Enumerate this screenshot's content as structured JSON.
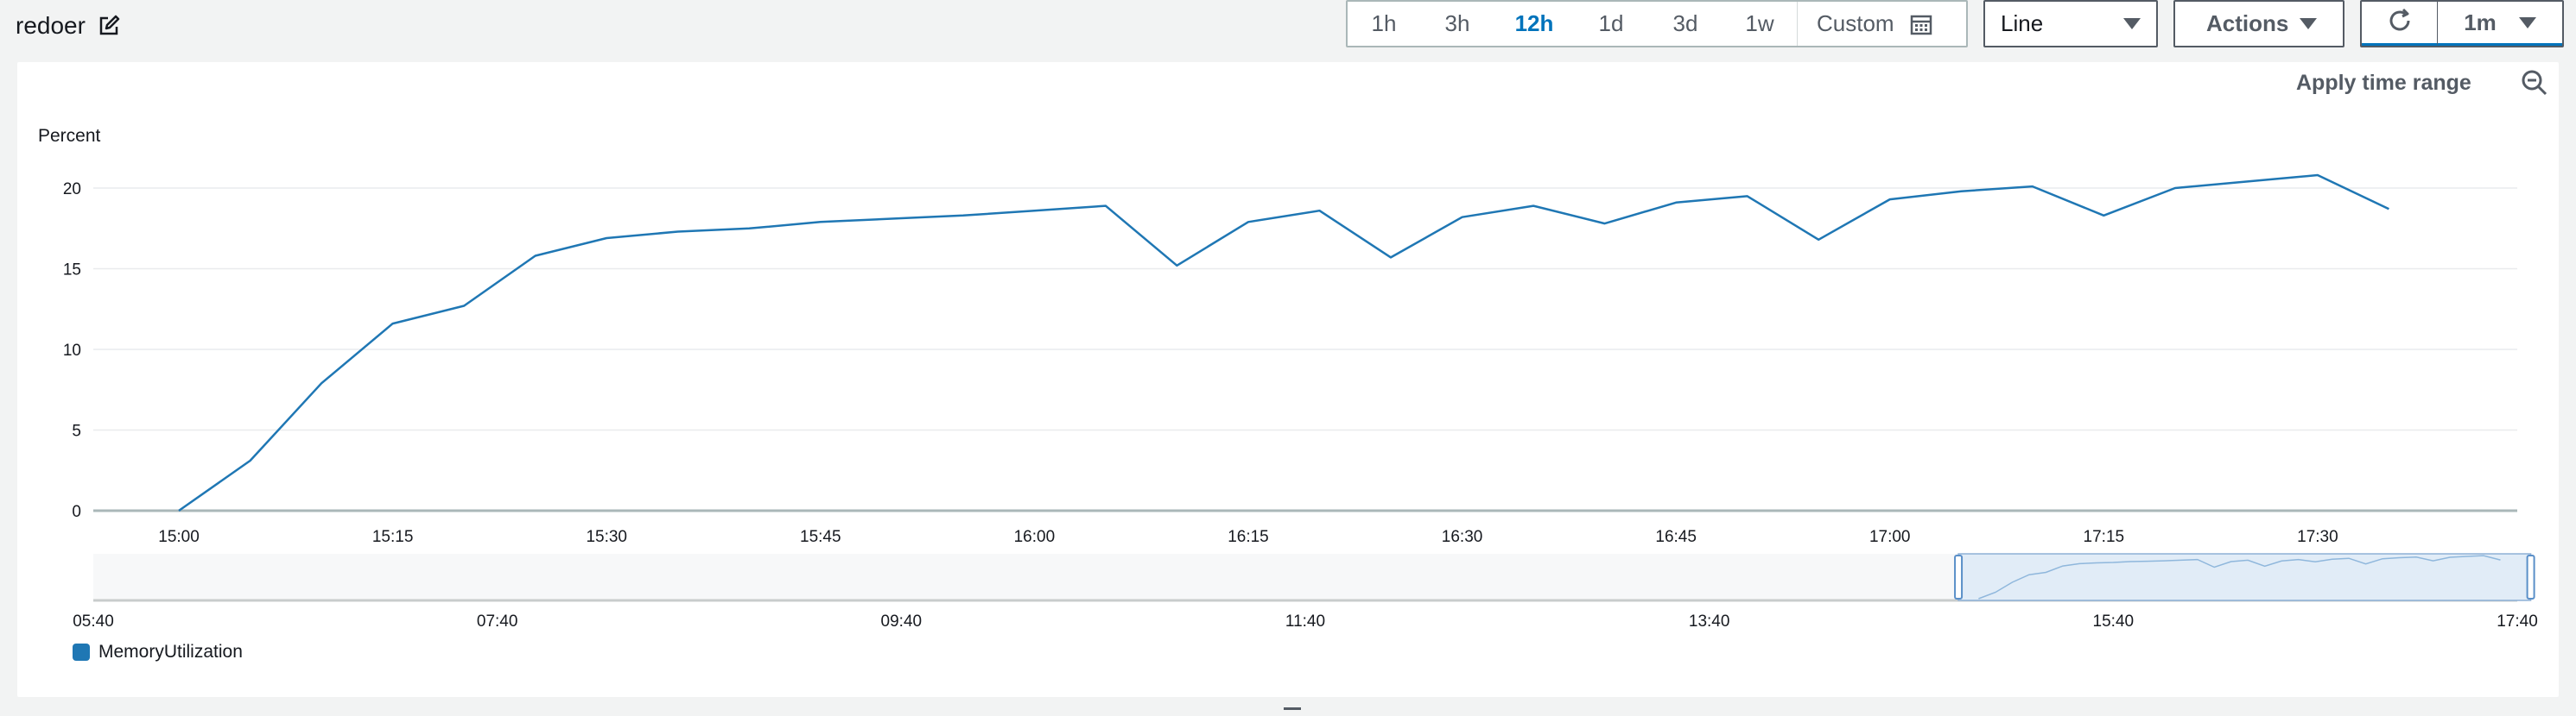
{
  "header": {
    "title": "redoer",
    "time_ranges": [
      "1h",
      "3h",
      "12h",
      "1d",
      "3d",
      "1w"
    ],
    "active_range": "12h",
    "custom_label": "Custom",
    "chart_type_label": "Line",
    "actions_label": "Actions",
    "refresh_interval_label": "1m"
  },
  "panel": {
    "apply_time_range_label": "Apply time range"
  },
  "colors": {
    "series": "#1f77b4",
    "accent": "#0073bb",
    "grid": "#e9ebed"
  },
  "icons": [
    "edit-icon",
    "calendar-icon",
    "refresh-icon",
    "zoom-out-icon",
    "chevron-down-icon"
  ],
  "chart_data": {
    "type": "line",
    "ylabel": "Percent",
    "ylim": [
      0,
      20
    ],
    "yticks": [
      0,
      5,
      10,
      15,
      20
    ],
    "xticks": [
      "15:00",
      "15:15",
      "15:30",
      "15:45",
      "16:00",
      "16:15",
      "16:30",
      "16:45",
      "17:00",
      "17:15",
      "17:30"
    ],
    "xlim": [
      "14:54",
      "17:44"
    ],
    "grid": "horizontal",
    "legend_position": "bottom-left",
    "series": [
      {
        "name": "MemoryUtilization",
        "x": [
          "15:00",
          "15:05",
          "15:10",
          "15:15",
          "15:20",
          "15:25",
          "15:30",
          "15:35",
          "15:40",
          "15:45",
          "15:50",
          "15:55",
          "16:00",
          "16:05",
          "16:10",
          "16:15",
          "16:20",
          "16:25",
          "16:30",
          "16:35",
          "16:40",
          "16:45",
          "16:50",
          "16:55",
          "17:00",
          "17:05",
          "17:10",
          "17:15",
          "17:20",
          "17:25",
          "17:30",
          "17:35"
        ],
        "values": [
          0,
          3.1,
          7.9,
          11.6,
          12.7,
          15.8,
          16.9,
          17.3,
          17.5,
          17.9,
          18.1,
          18.3,
          18.6,
          18.9,
          15.2,
          17.9,
          18.6,
          15.7,
          18.2,
          18.9,
          17.8,
          19.1,
          19.5,
          16.8,
          19.3,
          19.8,
          20.1,
          18.3,
          20.0,
          20.4,
          20.8,
          18.7
        ]
      }
    ],
    "navigator": {
      "xticks": [
        "05:40",
        "07:40",
        "09:40",
        "11:40",
        "13:40",
        "15:40",
        "17:40"
      ],
      "selection": [
        "14:54",
        "17:44"
      ]
    }
  }
}
